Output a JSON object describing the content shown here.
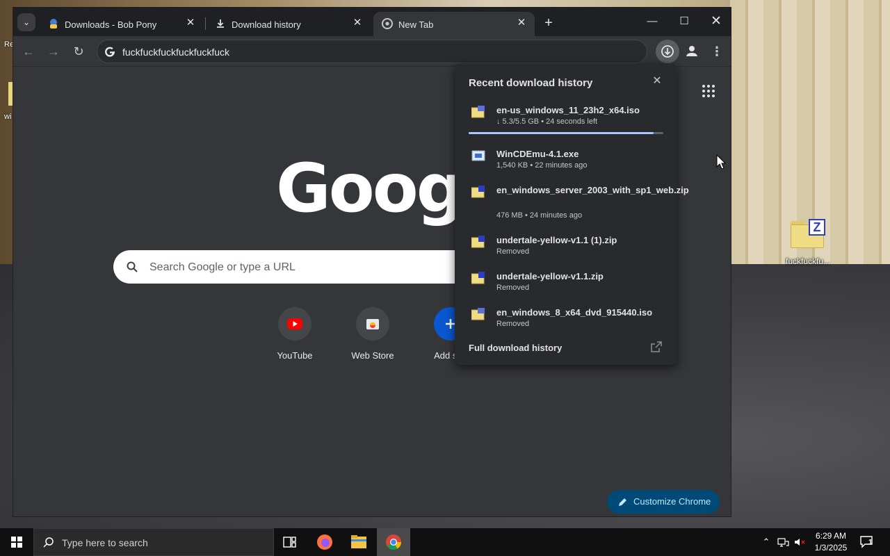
{
  "desktop": {
    "icon_label": "fuckfuckfu...",
    "left_fragments": [
      "Re",
      "wi"
    ]
  },
  "browser": {
    "tabs": [
      {
        "title": "Downloads - Bob Pony",
        "icon": "bob-pony-favicon"
      },
      {
        "title": "Download history",
        "icon": "download-icon"
      },
      {
        "title": "New Tab",
        "icon": "chrome-icon",
        "active": true
      }
    ],
    "omnibox": {
      "text": "fuckfuckfuckfuckfuckfuck"
    },
    "newtab": {
      "search_placeholder": "Search Google or type a URL",
      "logo_text": "Google",
      "shortcuts": [
        {
          "label": "YouTube",
          "icon": "youtube-icon"
        },
        {
          "label": "Web Store",
          "icon": "web-store-icon"
        },
        {
          "label": "Add sho",
          "icon": "plus-icon"
        }
      ],
      "customize_label": "Customize Chrome"
    }
  },
  "downloads": {
    "title": "Recent download history",
    "items": [
      {
        "name": "en-us_windows_11_23h2_x64.iso",
        "status": "↓ 5.3/5.5 GB • 24 seconds left",
        "type": "iso",
        "progress": 0.95
      },
      {
        "name": "WinCDEmu-4.1.exe",
        "status": "1,540 KB • 22 minutes ago",
        "type": "exe"
      },
      {
        "name": "en_windows_server_2003_with_sp1_web.zip",
        "status": "476 MB • 24 minutes ago",
        "type": "zip"
      },
      {
        "name": "undertale-yellow-v1.1 (1).zip",
        "status": "Removed",
        "type": "zip"
      },
      {
        "name": "undertale-yellow-v1.1.zip",
        "status": "Removed",
        "type": "zip"
      },
      {
        "name": "en_windows_8_x64_dvd_915440.iso",
        "status": "Removed",
        "type": "iso"
      }
    ],
    "footer": "Full download history"
  },
  "taskbar": {
    "search_placeholder": "Type here to search",
    "time": "6:29 AM",
    "date": "1/3/2025",
    "notification_count": "1"
  },
  "colors": {
    "accent": "#a8c7fa",
    "customize_bg": "#004a77",
    "panel_bg": "#292a2d",
    "browser_bg": "#35363a"
  }
}
